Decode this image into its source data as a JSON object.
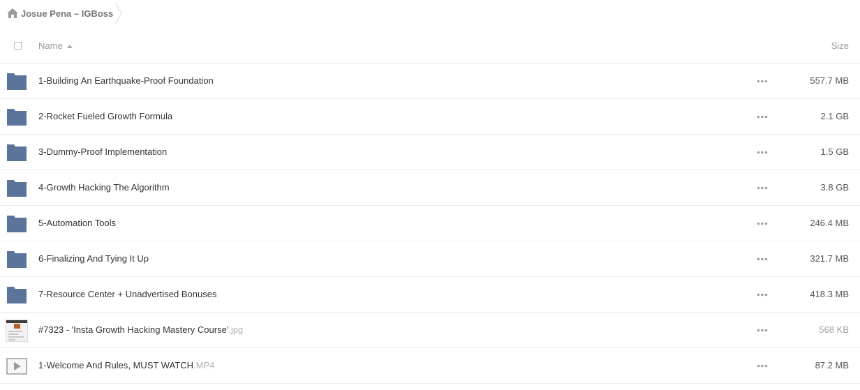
{
  "breadcrumb": {
    "label": "Josue Pena – IGBoss"
  },
  "header": {
    "name_label": "Name",
    "size_label": "Size"
  },
  "colors": {
    "folder": "#5b7499",
    "text": "#333333",
    "muted": "#999999"
  },
  "rows": [
    {
      "type": "folder",
      "icon": "folder-icon",
      "name": "1-Building An Earthquake-Proof Foundation",
      "ext": "",
      "size": "557.7 MB"
    },
    {
      "type": "folder",
      "icon": "folder-icon",
      "name": "2-Rocket Fueled Growth Formula",
      "ext": "",
      "size": "2.1 GB"
    },
    {
      "type": "folder",
      "icon": "folder-icon",
      "name": "3-Dummy-Proof Implementation",
      "ext": "",
      "size": "1.5 GB"
    },
    {
      "type": "folder",
      "icon": "folder-icon",
      "name": "4-Growth Hacking The Algorithm",
      "ext": "",
      "size": "3.8 GB"
    },
    {
      "type": "folder",
      "icon": "folder-icon",
      "name": "5-Automation Tools",
      "ext": "",
      "size": "246.4 MB"
    },
    {
      "type": "folder",
      "icon": "folder-icon",
      "name": "6-Finalizing And Tying It Up",
      "ext": "",
      "size": "321.7 MB"
    },
    {
      "type": "folder",
      "icon": "folder-icon",
      "name": "7-Resource Center + Unadvertised Bonuses",
      "ext": "",
      "size": "418.3 MB"
    },
    {
      "type": "image",
      "icon": "image-thumbnail",
      "name": "#7323 - 'Insta Growth Hacking Mastery Course'",
      "ext": ".jpg",
      "size": "568 KB"
    },
    {
      "type": "video",
      "icon": "video-play-icon",
      "name": "1-Welcome And Rules, MUST WATCH",
      "ext": ".MP4",
      "size": "87.2 MB"
    }
  ]
}
